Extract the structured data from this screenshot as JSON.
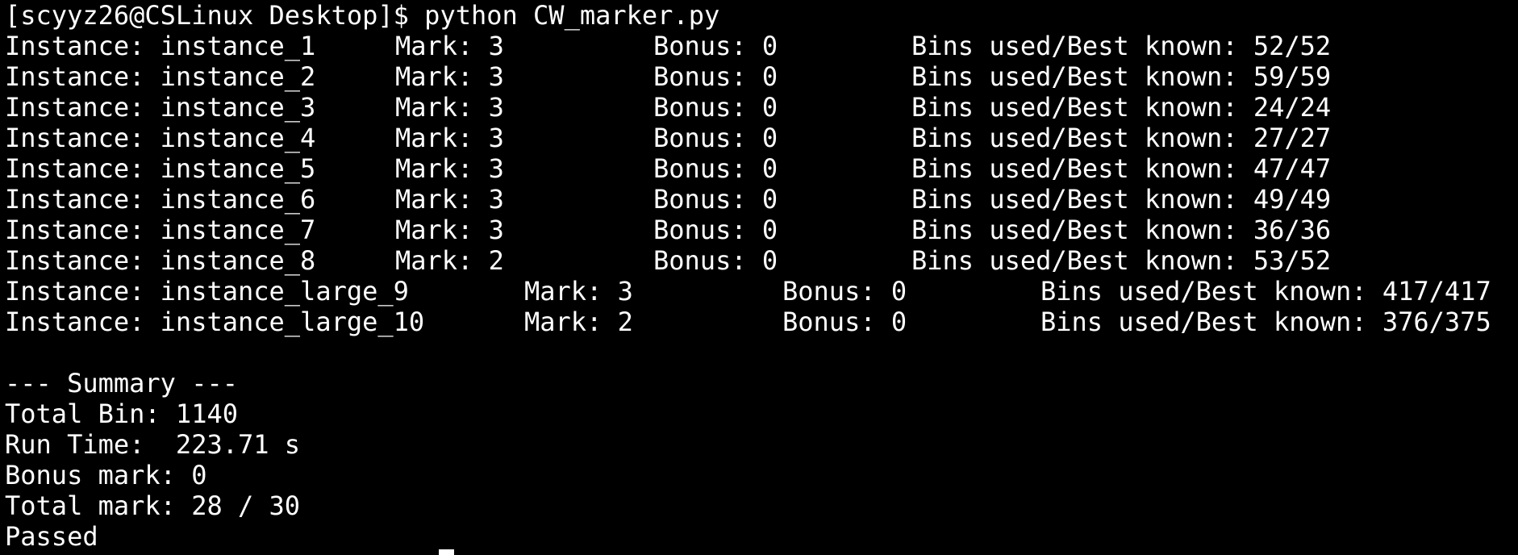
{
  "prompt": {
    "text": "[scyyz26@CSLinux Desktop]$ python CW_marker.py"
  },
  "results": [
    {
      "instance": "Instance: instance_1",
      "mark": "Mark: 3",
      "bonus": "Bonus: 0",
      "bins": "Bins used/Best known: 52/52"
    },
    {
      "instance": "Instance: instance_2",
      "mark": "Mark: 3",
      "bonus": "Bonus: 0",
      "bins": "Bins used/Best known: 59/59"
    },
    {
      "instance": "Instance: instance_3",
      "mark": "Mark: 3",
      "bonus": "Bonus: 0",
      "bins": "Bins used/Best known: 24/24"
    },
    {
      "instance": "Instance: instance_4",
      "mark": "Mark: 3",
      "bonus": "Bonus: 0",
      "bins": "Bins used/Best known: 27/27"
    },
    {
      "instance": "Instance: instance_5",
      "mark": "Mark: 3",
      "bonus": "Bonus: 0",
      "bins": "Bins used/Best known: 47/47"
    },
    {
      "instance": "Instance: instance_6",
      "mark": "Mark: 3",
      "bonus": "Bonus: 0",
      "bins": "Bins used/Best known: 49/49"
    },
    {
      "instance": "Instance: instance_7",
      "mark": "Mark: 3",
      "bonus": "Bonus: 0",
      "bins": "Bins used/Best known: 36/36"
    },
    {
      "instance": "Instance: instance_8",
      "mark": "Mark: 2",
      "bonus": "Bonus: 0",
      "bins": "Bins used/Best known: 53/52"
    }
  ],
  "large_results": [
    {
      "instance": "Instance: instance_large_9",
      "mark": "Mark: 3",
      "bonus": "Bonus: 0",
      "bins": "Bins used/Best known: 417/417"
    },
    {
      "instance": "Instance: instance_large_10",
      "mark": "Mark: 2",
      "bonus": "Bonus: 0",
      "bins": "Bins used/Best known: 376/375"
    }
  ],
  "summary": {
    "header": "--- Summary ---",
    "total_bin": "Total Bin: 1140",
    "run_time": "Run Time:  223.71 s",
    "bonus_mark": "Bonus mark: 0",
    "total_mark": "Total mark: 28 / 30",
    "status": "Passed"
  },
  "colors": {
    "background": "#000000",
    "foreground": "#ffffff"
  }
}
